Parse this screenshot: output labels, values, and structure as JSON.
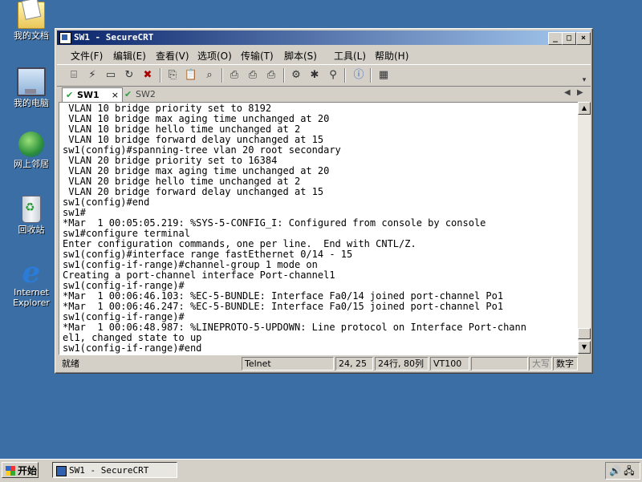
{
  "desktop": {
    "icons": [
      {
        "label": "我的文档",
        "icon": "my-documents-icon"
      },
      {
        "label": "我的电脑",
        "icon": "my-computer-icon"
      },
      {
        "label": "网上邻居",
        "icon": "network-places-icon"
      },
      {
        "label": "回收站",
        "icon": "recycle-bin-icon"
      },
      {
        "label": "Internet Explorer",
        "icon": "internet-explorer-icon"
      }
    ]
  },
  "window": {
    "title": "SW1 - SecureCRT",
    "controls": {
      "minimize": "_",
      "maximize": "□",
      "close": "×"
    },
    "menu": [
      "文件(F)",
      "编辑(E)",
      "查看(V)",
      "选项(O)",
      "传输(T)",
      "脚本(S)",
      "工具(L)",
      "帮助(H)"
    ],
    "toolbar_icons": [
      "connect-icon",
      "quick-connect-icon",
      "connect-tab-icon",
      "reconnect-icon",
      "disconnect-icon",
      "copy-icon",
      "paste-icon",
      "find-icon",
      "print-icon",
      "print-selection-icon",
      "print-setup-icon",
      "session-options-icon",
      "global-options-icon",
      "keymap-icon",
      "help-icon",
      "screen-icon"
    ],
    "tabs": [
      {
        "label": "SW1",
        "active": true,
        "status": "connected"
      },
      {
        "label": "SW2",
        "active": false,
        "status": "connected"
      }
    ],
    "terminal_lines": [
      " VLAN 10 bridge priority set to 8192",
      " VLAN 10 bridge max aging time unchanged at 20",
      " VLAN 10 bridge hello time unchanged at 2",
      " VLAN 10 bridge forward delay unchanged at 15",
      "sw1(config)#spanning-tree vlan 20 root secondary",
      " VLAN 20 bridge priority set to 16384",
      " VLAN 20 bridge max aging time unchanged at 20",
      " VLAN 20 bridge hello time unchanged at 2",
      " VLAN 20 bridge forward delay unchanged at 15",
      "sw1(config)#end",
      "sw1#",
      "*Mar  1 00:05:05.219: %SYS-5-CONFIG_I: Configured from console by console",
      "sw1#configure terminal",
      "Enter configuration commands, one per line.  End with CNTL/Z.",
      "sw1(config)#interface range fastEthernet 0/14 - 15",
      "sw1(config-if-range)#channel-group 1 mode on",
      "Creating a port-channel interface Port-channel1",
      "sw1(config-if-range)#",
      "*Mar  1 00:06:46.103: %EC-5-BUNDLE: Interface Fa0/14 joined port-channel Po1",
      "*Mar  1 00:06:46.247: %EC-5-BUNDLE: Interface Fa0/15 joined port-channel Po1",
      "sw1(config-if-range)#",
      "*Mar  1 00:06:48.987: %LINEPROTO-5-UPDOWN: Line protocol on Interface Port-chann",
      "el1, changed state to up",
      "sw1(config-if-range)#end"
    ],
    "status": {
      "ready": "就绪",
      "protocol": "Telnet",
      "cursor": "24, 25",
      "size": "24行, 80列",
      "emulation": "VT100",
      "blank": "",
      "caps": "大写",
      "num": "数字"
    }
  },
  "taskbar": {
    "start_label": "开始",
    "task_label": "SW1 - SecureCRT",
    "tray_icons": [
      "volume-icon",
      "network-tray-icon"
    ]
  }
}
